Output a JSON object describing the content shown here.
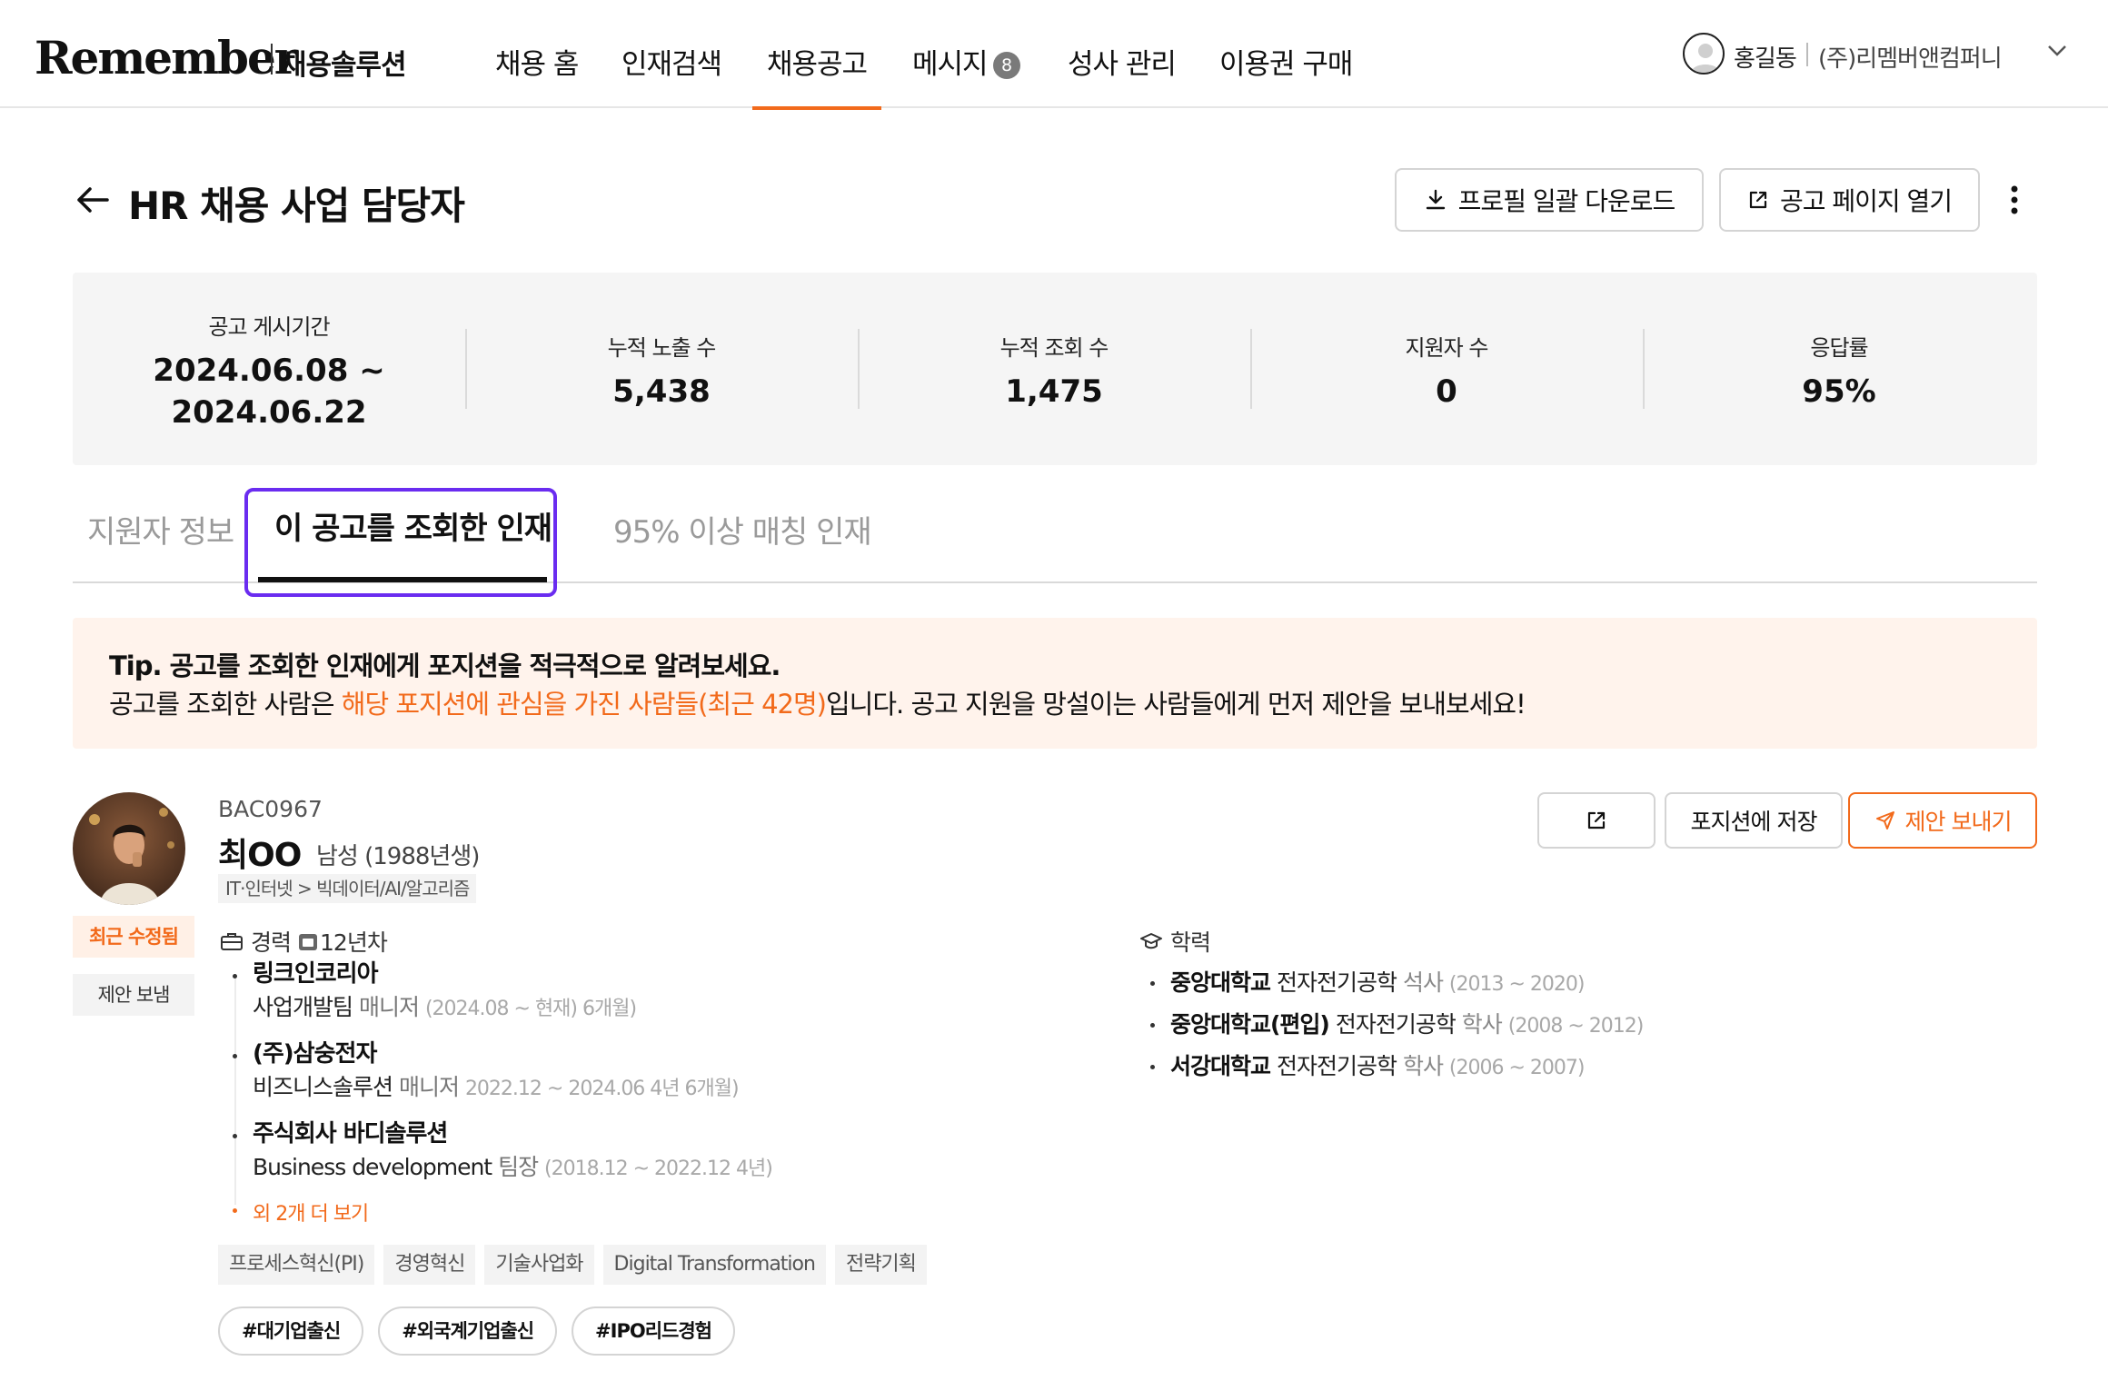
{
  "nav": {
    "logo": "Remember",
    "logo_sub": "채용솔루션",
    "items": [
      {
        "label": "채용 홈"
      },
      {
        "label": "인재검색"
      },
      {
        "label": "채용공고"
      },
      {
        "label": "메시지"
      },
      {
        "label": "성사 관리"
      },
      {
        "label": "이용권 구매"
      }
    ],
    "active_index": 2,
    "message_count": "8",
    "user_name": "홍길동",
    "company": "(주)리멤버앤컴퍼니"
  },
  "header": {
    "title": "HR 채용 사업 담당자",
    "download_label": "프로필 일괄 다운로드",
    "open_page_label": "공고 페이지 열기"
  },
  "stats": [
    {
      "label": "공고 게시기간",
      "value_line1": "2024.06.08 ~",
      "value_line2": "2024.06.22"
    },
    {
      "label": "누적 노출 수",
      "value": "5,438"
    },
    {
      "label": "누적 조회 수",
      "value": "1,475"
    },
    {
      "label": "지원자 수",
      "value": "0"
    },
    {
      "label": "응답률",
      "value": "95%"
    }
  ],
  "tabs": [
    {
      "label": "지원자 정보"
    },
    {
      "label": "이 공고를 조회한 인재"
    },
    {
      "label": "95% 이상 매칭 인재"
    }
  ],
  "tip": {
    "title": "Tip. 공고를 조회한 인재에게 포지션을 적극적으로 알려보세요.",
    "body_prefix": "공고를 조회한 사람은 ",
    "body_highlight": "해당 포지션에 관심을 가진 사람들(최근 42명)",
    "body_suffix": "입니다. 공고 지원을 망설이는 사람들에게 먼저 제안을 보내보세요!"
  },
  "candidate": {
    "badge_recent": "최근 수정됨",
    "badge_sent": "제안 보냄",
    "code": "BAC0967",
    "name": "최OO",
    "gender_birth": "남성 (1988년생)",
    "industry": "IT·인터넷 > 빅데이터/AI/알고리즘",
    "buttons": {
      "save": "포지션에 저장",
      "propose": "제안 보내기"
    },
    "career": {
      "heading": "경력",
      "years": "12년차",
      "items": [
        {
          "company": "링크인코리아",
          "dept": "사업개발팀",
          "position": "매니저",
          "period": "(2024.08 ~ 현재) 6개월)"
        },
        {
          "company": "(주)삼숭전자",
          "dept": "비즈니스솔루션",
          "position": "매니저",
          "period": "2022.12 ~ 2024.06 4년 6개월)"
        },
        {
          "company": "주식회사 바디솔루션",
          "dept": "Business development",
          "position": "팀장",
          "period": "(2018.12 ~ 2022.12 4년)"
        }
      ],
      "more": "외 2개 더 보기"
    },
    "education": {
      "heading": "학력",
      "items": [
        {
          "school": "중앙대학교",
          "major": "전자전기공학",
          "degree": "석사",
          "period": "(2013 ~ 2020)"
        },
        {
          "school": "중앙대학교(편입)",
          "major": "전자전기공학",
          "degree": "학사",
          "period": "(2008 ~ 2012)"
        },
        {
          "school": "서강대학교",
          "major": "전자전기공학",
          "degree": "학사",
          "period": "(2006 ~ 2007)"
        }
      ]
    },
    "skills": [
      "프로세스혁신(PI)",
      "경영혁신",
      "기술사업화",
      "Digital Transformation",
      "전략기획"
    ],
    "hashtags": [
      "#대기업출신",
      "#외국계기업출신",
      "#IPO리드경험"
    ]
  },
  "colors": {
    "accent": "#f26a1b",
    "focus_ring": "#6a2cf0",
    "tip_bg": "#fff3ec"
  }
}
